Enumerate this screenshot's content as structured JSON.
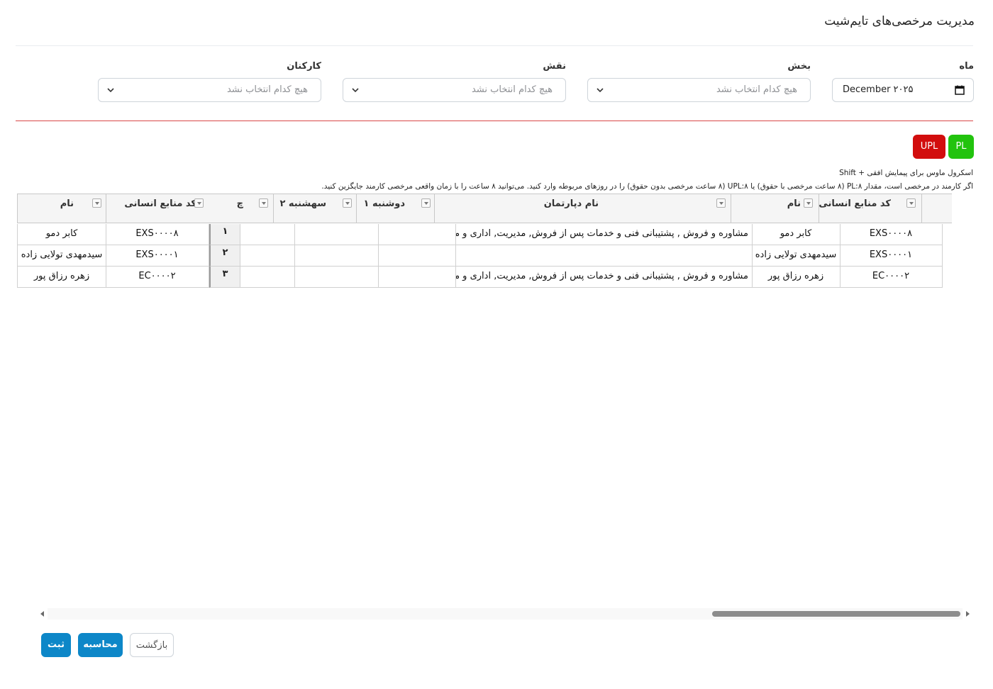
{
  "page": {
    "title": "مدیریت مرخصی‌های تایم‌شیت"
  },
  "filters": {
    "month": {
      "label": "ماه",
      "value": "December ۲۰۲۵"
    },
    "section": {
      "label": "بخش",
      "placeholder": "هیچ کدام انتخاب نشد"
    },
    "role": {
      "label": "نقش",
      "placeholder": "هیچ کدام انتخاب نشد"
    },
    "staff": {
      "label": "کارکنان",
      "placeholder": "هیچ کدام انتخاب نشد"
    }
  },
  "badges": {
    "pl": "PL",
    "upl": "UPL",
    "pl_color": "#22c30e",
    "upl_color": "#d20d0d"
  },
  "hints": {
    "scroll": "Shift + اسکرول ماوس برای پیمایش افقی",
    "info": "اگر کارمند در مرخصی است، مقدار PL:۸ (۸ ساعت مرخصی با حقوق) یا UPL:۸ (۸ ساعت مرخصی بدون حقوق) را در روزهای مربوطه وارد کنید. می‌توانید ۸ ساعت را با زمان واقعی مرخصی کارمند جایگزین کنید."
  },
  "grid": {
    "headers": {
      "hr_code": "کد منابع انسانی",
      "name": "نام",
      "department": "نام دپارتمان",
      "mon1": "دوشنبه ۱",
      "tue2": "سهشنبه ۲",
      "partial": "چ",
      "hr_code_frozen": "کد منابع انسانی",
      "name_frozen": "نام"
    },
    "rows": [
      {
        "num": "۱",
        "hr_code": "EXS۰۰۰۰۸",
        "name": "کابر دمو",
        "department": "مشاوره و فروش , پشتیبانی فنی و خدمات پس از فروش, مدیریت, اداری و مالی",
        "mon1": "",
        "tue2": "",
        "hr_code_frozen": "EXS۰۰۰۰۸",
        "name_frozen": "کابر دمو"
      },
      {
        "num": "۲",
        "hr_code": "EXS۰۰۰۰۱",
        "name": "سیدمهدی تولایی زاده",
        "department": "",
        "mon1": "",
        "tue2": "",
        "hr_code_frozen": "EXS۰۰۰۰۱",
        "name_frozen": "سیدمهدی تولایی زاده"
      },
      {
        "num": "۳",
        "hr_code": "EC۰۰۰۰۲",
        "name": "زهره رزاق پور",
        "department": "مشاوره و فروش , پشتیبانی فنی و خدمات پس از فروش, مدیریت, اداری و مالی",
        "mon1": "",
        "tue2": "",
        "hr_code_frozen": "EC۰۰۰۰۲",
        "name_frozen": "زهره رزاق پور"
      }
    ]
  },
  "actions": {
    "save": "ثبت",
    "calculate": "محاسبه",
    "back": "بازگشت",
    "primary_color": "#0d87c8"
  }
}
